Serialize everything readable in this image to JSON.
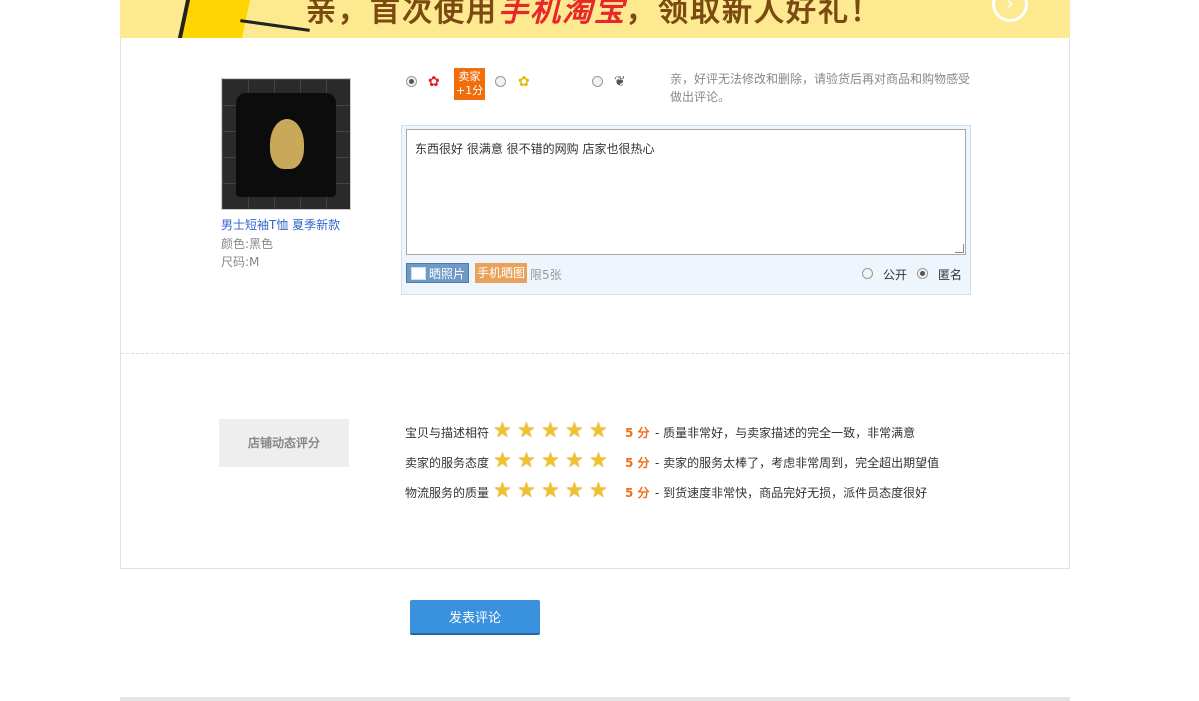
{
  "banner": {
    "text_prefix": "亲，首次使用",
    "text_highlight": "手机淘宝",
    "text_suffix": "，领取新人好礼！",
    "arrow": "arrow-right-icon"
  },
  "product": {
    "name": "男士短袖T恤 夏季新款",
    "color": "颜色:黑色",
    "size": "尺码:M"
  },
  "rating": {
    "options": [
      "good",
      "neutral",
      "bad"
    ],
    "selected": "good",
    "seller_badge_line1": "卖家",
    "seller_badge_line2": "+1分",
    "hint": "亲，好评无法修改和删除，请验货后再对商品和购物感受做出评论。"
  },
  "review": {
    "text": "东西很好 很满意 很不错的网购 店家也很热心",
    "photo_button": "晒照片",
    "mobile_button": "手机晒图",
    "limit": "限5张",
    "public_label": "公开",
    "anonymous_label": "匿名",
    "visibility_selected": "anonymous"
  },
  "dsr": {
    "section_label": "店铺动态评分",
    "items": [
      {
        "name": "宝贝与描述相符",
        "stars": 5,
        "score": "5 分",
        "desc": "- 质量非常好，与卖家描述的完全一致，非常满意"
      },
      {
        "name": "卖家的服务态度",
        "stars": 5,
        "score": "5 分",
        "desc": "- 卖家的服务太棒了，考虑非常周到，完全超出期望值"
      },
      {
        "name": "物流服务的质量",
        "stars": 5,
        "score": "5 分",
        "desc": "- 到货速度非常快，商品完好无损，派件员态度很好"
      }
    ]
  },
  "submit": {
    "label": "发表评论"
  },
  "colors": {
    "accent": "#3a91de",
    "score": "#f26c1a",
    "badge": "#f06f0c",
    "banner_bg": "#fde98f"
  }
}
